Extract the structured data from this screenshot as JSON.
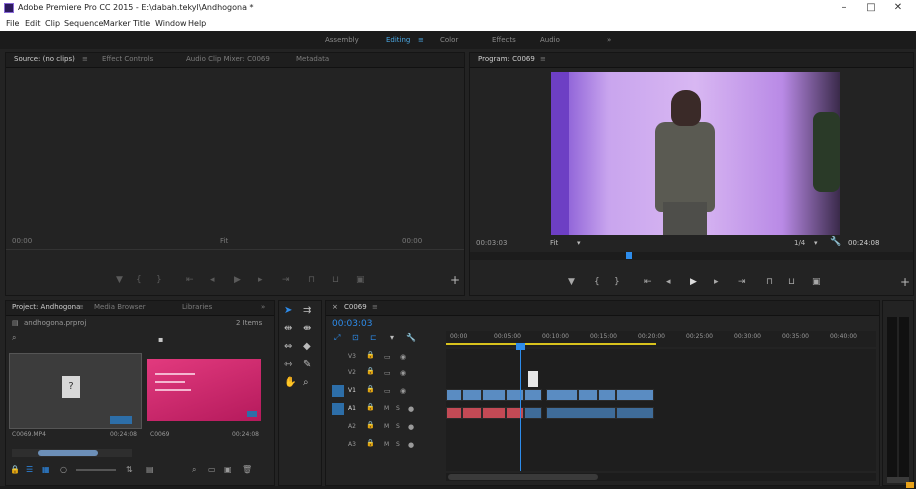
{
  "window": {
    "title": "Adobe Premiere Pro CC 2015 - E:\\dabah.tekyl\\Andhogona *",
    "minimize": "–",
    "maximize": "□",
    "close": "✕"
  },
  "menu": [
    "File",
    "Edit",
    "Clip",
    "Sequence",
    "Marker",
    "Title",
    "Window",
    "Help"
  ],
  "workspaces": [
    "Assembly",
    "Editing",
    "Color",
    "Effects",
    "Audio",
    "»"
  ],
  "workspace_menu": "≡",
  "source_panel": {
    "tabs": [
      "Source: (no clips)",
      "Effect Controls",
      "Audio Clip Mixer: C0069",
      "Metadata"
    ],
    "tab_menu": "≡",
    "timecode_left": "00:00",
    "timecode_right": "00:00",
    "zoom": "Fit"
  },
  "program_panel": {
    "tab": "Program: C0069",
    "tab_menu": "≡",
    "timecode_left": "00:03:03",
    "zoom": "Fit",
    "resolution": "1/4",
    "timecode_right": "00:24:08"
  },
  "project_panel": {
    "tabs": [
      "Project: Andhogona",
      "Media Browser",
      "Libraries"
    ],
    "tab_menu": "≡",
    "file": "andhogona.prproj",
    "count": "2 Items",
    "items": [
      {
        "name": "C0069.MP4",
        "duration": "00:24:08"
      },
      {
        "name": "C0069",
        "duration": "00:24:08"
      }
    ]
  },
  "timeline": {
    "tab": "C0069",
    "tab_menu": "≡",
    "timecode": "00:03:03",
    "ruler": [
      "00:00",
      "00:05:00",
      "00:10:00",
      "00:15:00",
      "00:20:00",
      "00:25:00",
      "00:30:00",
      "00:35:00",
      "00:40:00"
    ],
    "tracks": [
      "V3",
      "V2",
      "V1",
      "A1",
      "A2",
      "A3"
    ],
    "track_toggles": [
      "M",
      "S"
    ]
  },
  "colors": {
    "accent": "#2d8ceb",
    "video_clip": "#5a8cc2",
    "audio_clip": "#3f6c99",
    "red_clip": "#c24a55",
    "workarea": "#d8c21d"
  }
}
